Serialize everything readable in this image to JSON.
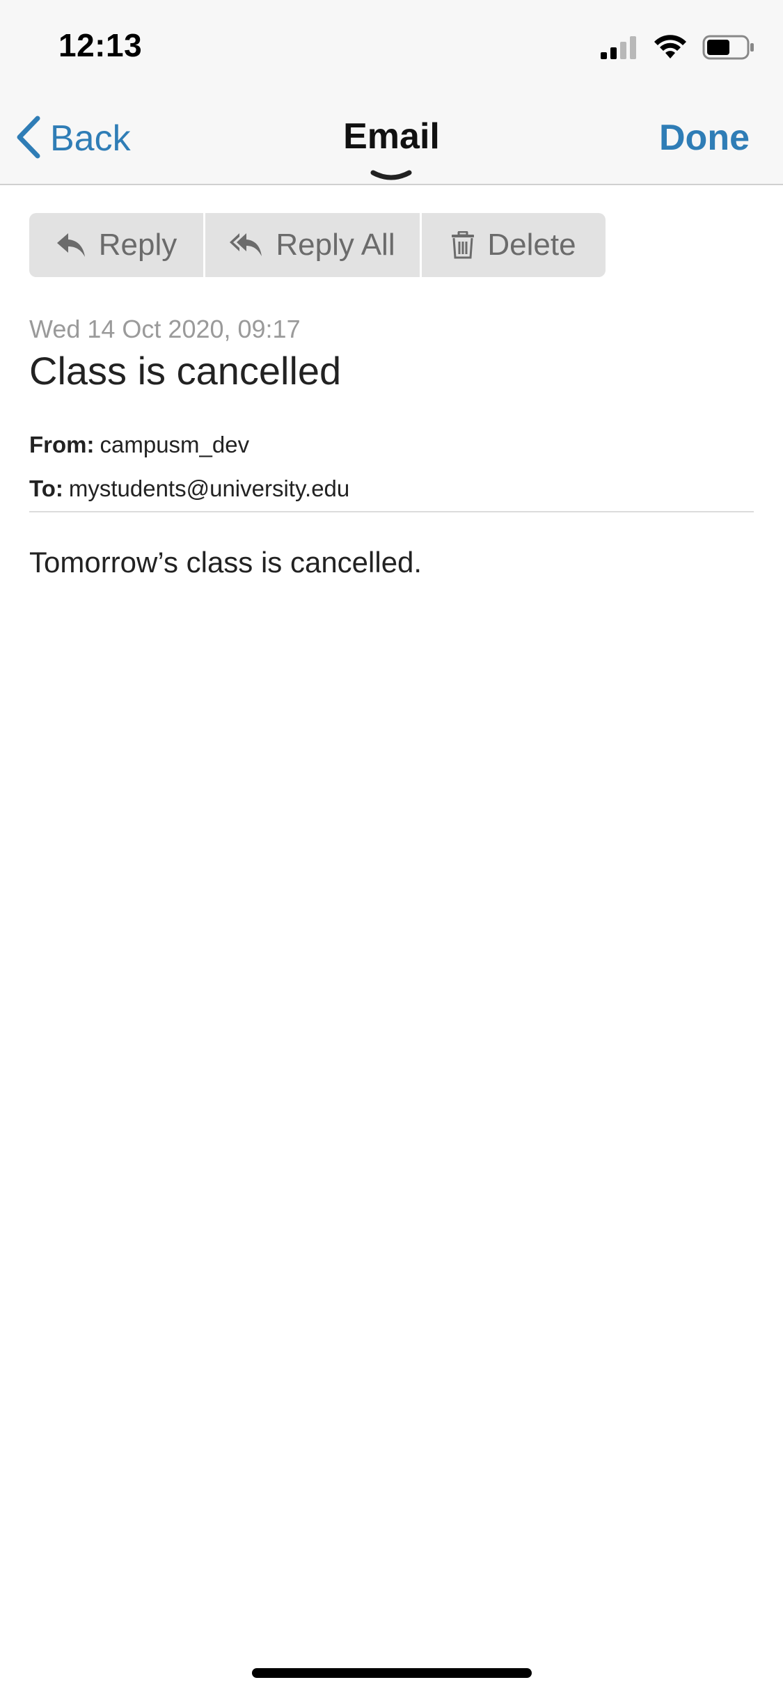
{
  "status_bar": {
    "time": "12:13"
  },
  "nav": {
    "back_label": "Back",
    "title": "Email",
    "done_label": "Done",
    "accent_color": "#2f7db6"
  },
  "actions": {
    "reply_label": "Reply",
    "reply_all_label": "Reply All",
    "delete_label": "Delete"
  },
  "email": {
    "date": "Wed 14 Oct 2020, 09:17",
    "subject": "Class is cancelled",
    "from_label": "From:",
    "from_value": "campusm_dev",
    "to_label": "To:",
    "to_value": "mystudents@university.edu",
    "body": "Tomorrow’s class is cancelled."
  },
  "icons": {
    "signal": "cellular-signal-icon",
    "wifi": "wifi-icon",
    "battery": "battery-icon",
    "back": "chevron-left-icon",
    "handle": "chevron-down-icon",
    "reply": "reply-icon",
    "reply_all": "reply-all-icon",
    "delete": "trash-icon"
  }
}
